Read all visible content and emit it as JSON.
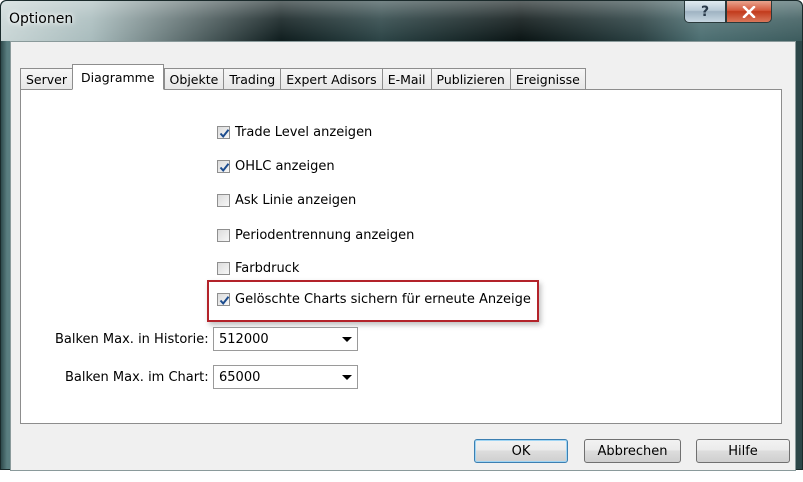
{
  "window": {
    "title": "Optionen"
  },
  "caption": {
    "help_glyph": "?",
    "close_glyph": "x"
  },
  "tabs": [
    {
      "label": "Server",
      "active": false
    },
    {
      "label": "Diagramme",
      "active": true
    },
    {
      "label": "Objekte",
      "active": false
    },
    {
      "label": "Trading",
      "active": false
    },
    {
      "label": "Expert Adisors",
      "active": false
    },
    {
      "label": "E-Mail",
      "active": false
    },
    {
      "label": "Publizieren",
      "active": false
    },
    {
      "label": "Ereignisse",
      "active": false
    }
  ],
  "options": [
    {
      "label": "Trade Level anzeigen",
      "checked": true
    },
    {
      "label": "OHLC anzeigen",
      "checked": true
    },
    {
      "label": "Ask Linie anzeigen",
      "checked": false
    },
    {
      "label": "Periodentrennung anzeigen",
      "checked": false
    },
    {
      "label": "Farbdruck",
      "checked": false
    },
    {
      "label": "Gelöschte Charts sichern für erneute Anzeige",
      "checked": true
    }
  ],
  "fields": {
    "max_bars_history": {
      "label": "Balken Max. in Historie:",
      "value": "512000"
    },
    "max_bars_chart": {
      "label": "Balken Max. im Chart:",
      "value": "65000"
    }
  },
  "buttons": {
    "ok": "OK",
    "cancel": "Abbrechen",
    "help": "Hilfe"
  },
  "colors": {
    "highlight_border": "#b3232a",
    "check_mark": "#1c4c8e"
  }
}
